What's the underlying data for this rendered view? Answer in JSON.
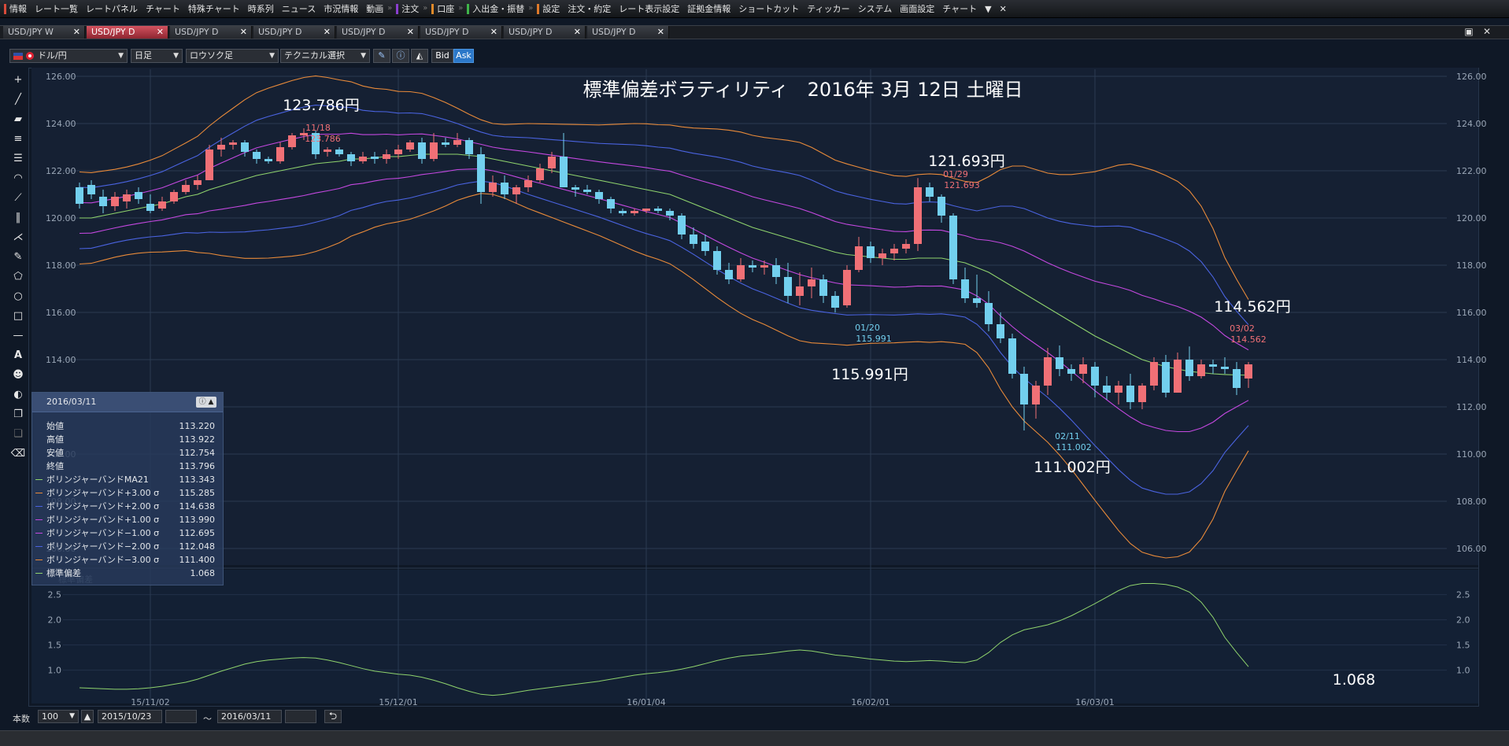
{
  "menu": [
    {
      "label": "情報",
      "mark": "#d94b3a"
    },
    {
      "label": "レート一覧"
    },
    {
      "label": "レートパネル"
    },
    {
      "label": "チャート"
    },
    {
      "label": "特殊チャート"
    },
    {
      "label": "時系列"
    },
    {
      "label": "ニュース"
    },
    {
      "label": "市況情報"
    },
    {
      "label": "動画"
    },
    {
      "label": "注文",
      "mark": "#8a3fd0",
      "sep": true
    },
    {
      "label": "口座",
      "mark": "#e08a2a",
      "sep": true
    },
    {
      "label": "入出金・振替",
      "mark": "#3fb54a",
      "sep": true
    },
    {
      "label": "設定",
      "mark": "#e07a2a",
      "sep": true
    },
    {
      "label": "注文・約定"
    },
    {
      "label": "レート表示設定"
    },
    {
      "label": "証拠金情報"
    },
    {
      "label": "ショートカット"
    },
    {
      "label": "ティッカー"
    },
    {
      "label": "システム"
    },
    {
      "label": "画面設定"
    },
    {
      "label": "チャート"
    },
    {
      "label": "▼"
    },
    {
      "label": "✕"
    }
  ],
  "tabs": [
    "USD/JPY W",
    "USD/JPY D",
    "USD/JPY D",
    "USD/JPY D",
    "USD/JPY D",
    "USD/JPY D",
    "USD/JPY D",
    "USD/JPY D"
  ],
  "active_tab": 1,
  "tab_close": "✕",
  "toolbar": {
    "currency": "ドル/円",
    "timeframe": "日足",
    "chart_type": "ロウソク足",
    "technical": "テクニカル選択",
    "bid": "Bid",
    "ask": "Ask"
  },
  "chart_title": "標準偏差ボラティリティ　2016年 3月 12日 土曜日",
  "annotations": {
    "high1_big": "123.786円",
    "high1_small_date": "11/18",
    "high1_small_val": "123.786",
    "high2_big": "121.693円",
    "high2_small_date": "01/29",
    "high2_small_val": "121.693",
    "low1_big": "115.991円",
    "low1_small_date": "01/20",
    "low1_small_val": "115.991",
    "low2_big": "111.002円",
    "low2_small_date": "02/11",
    "low2_small_val": "111.002",
    "high3_big": "114.562円",
    "high3_small_date": "03/02",
    "high3_small_val": "114.562",
    "sd_last": "1.068"
  },
  "data_panel": {
    "date": "2016/03/11",
    "rows": [
      {
        "label": "始値",
        "value": "113.220",
        "color": ""
      },
      {
        "label": "高値",
        "value": "113.922",
        "color": ""
      },
      {
        "label": "安値",
        "value": "112.754",
        "color": ""
      },
      {
        "label": "終値",
        "value": "113.796",
        "color": ""
      },
      {
        "label": "ボリンジャーバンドMA21",
        "value": "113.343",
        "color": "#8fd36d"
      },
      {
        "label": "ボリンジャーバンド+3.00 σ",
        "value": "115.285",
        "color": "#e88a3a"
      },
      {
        "label": "ボリンジャーバンド+2.00 σ",
        "value": "114.638",
        "color": "#4a63e0"
      },
      {
        "label": "ボリンジャーバンド+1.00 σ",
        "value": "113.990",
        "color": "#c448e0"
      },
      {
        "label": "ボリンジャーバンド−1.00 σ",
        "value": "112.695",
        "color": "#c448e0"
      },
      {
        "label": "ボリンジャーバンド−2.00 σ",
        "value": "112.048",
        "color": "#4a63e0"
      },
      {
        "label": "ボリンジャーバンド−3.00 σ",
        "value": "111.400",
        "color": "#e88a3a"
      },
      {
        "label": "標準偏差",
        "value": "1.068",
        "color": "#8fd36d"
      }
    ],
    "sub_label": "標準偏差"
  },
  "statusbar": {
    "count_label": "本数",
    "count_value": "100",
    "date_from": "2015/10/23",
    "tilde": "〜",
    "date_to": "2016/03/11"
  },
  "chart_data": {
    "type": "candlestick",
    "title": "標準偏差ボラティリティ　2016年 3月 12日 土曜日",
    "y_ticks": [
      "126.00",
      "124.00",
      "122.00",
      "120.00",
      "118.00",
      "116.00",
      "114.00",
      "112.00",
      "110.00",
      "108.00",
      "106.00"
    ],
    "ylim": [
      105.3,
      126.3
    ],
    "x_ticks": [
      "15/11/02",
      "15/12/01",
      "16/01/04",
      "16/02/01",
      "16/03/01"
    ],
    "x_tick_index": [
      6,
      27,
      48,
      67,
      86
    ],
    "colors": {
      "up": "#f07076",
      "down": "#72cfee",
      "ma": "#8fd36d",
      "s3": "#e88a3a",
      "s2": "#4a63e0",
      "s1": "#c448e0",
      "sd": "#8fd36d"
    },
    "candles_ohlc": [
      [
        121.3,
        121.5,
        120.4,
        120.6
      ],
      [
        121.4,
        121.6,
        120.8,
        121.0
      ],
      [
        120.9,
        121.2,
        120.2,
        120.5
      ],
      [
        120.5,
        121.1,
        120.3,
        120.9
      ],
      [
        120.7,
        121.2,
        120.4,
        121.0
      ],
      [
        121.1,
        121.3,
        120.6,
        120.8
      ],
      [
        120.6,
        121.0,
        120.2,
        120.3
      ],
      [
        120.4,
        120.9,
        120.3,
        120.7
      ],
      [
        120.7,
        121.2,
        120.6,
        121.1
      ],
      [
        121.1,
        121.6,
        121.0,
        121.4
      ],
      [
        121.4,
        121.8,
        121.2,
        121.6
      ],
      [
        121.6,
        123.1,
        121.6,
        122.9
      ],
      [
        122.9,
        123.4,
        122.6,
        123.1
      ],
      [
        123.1,
        123.3,
        122.9,
        123.2
      ],
      [
        123.2,
        123.3,
        122.6,
        122.8
      ],
      [
        122.8,
        122.9,
        122.3,
        122.5
      ],
      [
        122.5,
        122.6,
        122.3,
        122.4
      ],
      [
        122.4,
        123.2,
        122.3,
        123.0
      ],
      [
        123.0,
        123.6,
        122.9,
        123.5
      ],
      [
        123.5,
        123.8,
        123.3,
        123.6
      ],
      [
        123.6,
        123.7,
        122.5,
        122.7
      ],
      [
        122.8,
        123.0,
        122.6,
        122.9
      ],
      [
        122.9,
        123.0,
        122.6,
        122.7
      ],
      [
        122.7,
        122.8,
        122.2,
        122.4
      ],
      [
        122.4,
        122.8,
        122.3,
        122.6
      ],
      [
        122.6,
        122.8,
        122.3,
        122.5
      ],
      [
        122.5,
        122.9,
        122.3,
        122.7
      ],
      [
        122.7,
        123.1,
        122.5,
        122.9
      ],
      [
        122.9,
        123.3,
        122.8,
        123.2
      ],
      [
        123.2,
        123.4,
        122.3,
        122.5
      ],
      [
        122.5,
        123.6,
        122.4,
        123.2
      ],
      [
        123.2,
        123.4,
        123.0,
        123.1
      ],
      [
        123.1,
        123.6,
        123.0,
        123.3
      ],
      [
        123.3,
        123.4,
        122.5,
        122.7
      ],
      [
        122.7,
        123.0,
        120.6,
        121.1
      ],
      [
        121.1,
        121.8,
        120.9,
        121.5
      ],
      [
        121.5,
        121.8,
        120.8,
        121.0
      ],
      [
        121.0,
        121.4,
        120.6,
        121.3
      ],
      [
        121.3,
        121.8,
        121.1,
        121.6
      ],
      [
        121.6,
        122.3,
        121.5,
        122.1
      ],
      [
        122.1,
        122.8,
        121.9,
        122.6
      ],
      [
        122.6,
        123.6,
        121.8,
        121.3
      ],
      [
        121.3,
        121.4,
        120.9,
        121.2
      ],
      [
        121.2,
        121.4,
        121.0,
        121.1
      ],
      [
        121.1,
        121.2,
        120.6,
        120.8
      ],
      [
        120.8,
        120.9,
        120.2,
        120.4
      ],
      [
        120.3,
        120.4,
        120.1,
        120.2
      ],
      [
        120.2,
        120.4,
        120.1,
        120.3
      ],
      [
        120.3,
        120.4,
        120.2,
        120.4
      ],
      [
        120.4,
        120.5,
        120.2,
        120.3
      ],
      [
        120.3,
        120.4,
        119.9,
        120.1
      ],
      [
        120.1,
        120.2,
        119.1,
        119.3
      ],
      [
        119.3,
        119.6,
        118.7,
        118.9
      ],
      [
        119.0,
        119.3,
        118.4,
        118.6
      ],
      [
        118.6,
        118.8,
        117.6,
        117.8
      ],
      [
        117.8,
        118.1,
        117.2,
        117.4
      ],
      [
        117.4,
        118.3,
        117.3,
        118.0
      ],
      [
        118.0,
        118.2,
        117.7,
        117.9
      ],
      [
        117.9,
        118.2,
        117.6,
        118.0
      ],
      [
        118.0,
        118.3,
        117.2,
        117.5
      ],
      [
        117.5,
        118.1,
        116.4,
        116.7
      ],
      [
        116.7,
        117.7,
        116.3,
        117.1
      ],
      [
        117.1,
        117.9,
        116.6,
        117.4
      ],
      [
        117.4,
        117.6,
        116.4,
        116.7
      ],
      [
        116.7,
        116.9,
        115.99,
        116.2
      ],
      [
        116.3,
        118.0,
        116.2,
        117.8
      ],
      [
        117.8,
        119.2,
        117.7,
        118.8
      ],
      [
        118.8,
        119.0,
        118.1,
        118.3
      ],
      [
        118.3,
        118.7,
        118.0,
        118.5
      ],
      [
        118.5,
        118.9,
        118.2,
        118.7
      ],
      [
        118.7,
        119.1,
        118.5,
        118.9
      ],
      [
        118.9,
        121.69,
        118.6,
        121.3
      ],
      [
        121.3,
        121.5,
        120.7,
        120.9
      ],
      [
        120.9,
        121.0,
        119.8,
        120.1
      ],
      [
        120.1,
        120.2,
        117.2,
        117.4
      ],
      [
        117.4,
        117.9,
        116.4,
        116.6
      ],
      [
        116.6,
        117.6,
        116.2,
        116.4
      ],
      [
        116.4,
        116.9,
        115.2,
        115.5
      ],
      [
        115.5,
        116.0,
        114.7,
        114.9
      ],
      [
        114.9,
        115.1,
        113.2,
        113.4
      ],
      [
        113.4,
        113.7,
        111.0,
        112.1
      ],
      [
        112.1,
        113.1,
        111.5,
        112.9
      ],
      [
        112.9,
        114.5,
        112.5,
        114.1
      ],
      [
        114.1,
        114.6,
        113.3,
        113.6
      ],
      [
        113.6,
        113.8,
        113.1,
        113.4
      ],
      [
        113.4,
        114.1,
        113.0,
        113.8
      ],
      [
        113.7,
        113.9,
        112.4,
        112.9
      ],
      [
        112.9,
        113.3,
        112.3,
        112.6
      ],
      [
        112.6,
        113.1,
        112.1,
        112.9
      ],
      [
        112.9,
        113.4,
        111.9,
        112.2
      ],
      [
        112.2,
        113.0,
        111.9,
        112.9
      ],
      [
        112.9,
        114.1,
        112.7,
        113.9
      ],
      [
        113.9,
        114.2,
        112.4,
        112.6
      ],
      [
        112.6,
        114.3,
        112.6,
        114.0
      ],
      [
        114.0,
        114.56,
        113.1,
        113.3
      ],
      [
        113.3,
        114.0,
        113.2,
        113.8
      ],
      [
        113.8,
        114.0,
        113.4,
        113.7
      ],
      [
        113.7,
        114.1,
        113.4,
        113.6
      ],
      [
        113.6,
        113.9,
        112.5,
        112.8
      ],
      [
        113.2,
        113.9,
        112.8,
        113.8
      ]
    ],
    "bb_ma": [
      120.0,
      120.0,
      120.1,
      120.2,
      120.3,
      120.4,
      120.5,
      120.6,
      120.75,
      120.9,
      121.0,
      121.2,
      121.35,
      121.5,
      121.65,
      121.8,
      121.9,
      122.0,
      122.1,
      122.2,
      122.3,
      122.35,
      122.4,
      122.5,
      122.5,
      122.55,
      122.6,
      122.6,
      122.65,
      122.7,
      122.7,
      122.7,
      122.7,
      122.65,
      122.6,
      122.5,
      122.4,
      122.3,
      122.2,
      122.1,
      122.0,
      121.9,
      121.8,
      121.7,
      121.6,
      121.5,
      121.4,
      121.3,
      121.2,
      121.1,
      121.0,
      120.8,
      120.6,
      120.4,
      120.2,
      120.0,
      119.8,
      119.6,
      119.45,
      119.3,
      119.15,
      119.0,
      118.85,
      118.7,
      118.55,
      118.45,
      118.4,
      118.35,
      118.3,
      118.25,
      118.25,
      118.3,
      118.3,
      118.3,
      118.2,
      118.1,
      117.9,
      117.7,
      117.4,
      117.1,
      116.8,
      116.5,
      116.2,
      115.9,
      115.6,
      115.3,
      115.0,
      114.75,
      114.5,
      114.25,
      114.0,
      113.85,
      113.7,
      113.6,
      113.5,
      113.45,
      113.4,
      113.37,
      113.35,
      113.343
    ],
    "bb_width": [
      0.65,
      0.64,
      0.63,
      0.62,
      0.62,
      0.63,
      0.65,
      0.68,
      0.72,
      0.76,
      0.82,
      0.9,
      0.98,
      1.05,
      1.12,
      1.17,
      1.2,
      1.22,
      1.24,
      1.25,
      1.24,
      1.2,
      1.15,
      1.09,
      1.03,
      0.98,
      0.95,
      0.92,
      0.9,
      0.86,
      0.8,
      0.73,
      0.65,
      0.58,
      0.52,
      0.5,
      0.52,
      0.56,
      0.6,
      0.63,
      0.66,
      0.69,
      0.72,
      0.75,
      0.78,
      0.82,
      0.86,
      0.9,
      0.93,
      0.95,
      0.98,
      1.02,
      1.07,
      1.13,
      1.19,
      1.24,
      1.28,
      1.3,
      1.32,
      1.35,
      1.38,
      1.4,
      1.38,
      1.34,
      1.3,
      1.28,
      1.25,
      1.22,
      1.2,
      1.18,
      1.17,
      1.18,
      1.19,
      1.18,
      1.16,
      1.15,
      1.2,
      1.35,
      1.55,
      1.7,
      1.8,
      1.85,
      1.9,
      1.98,
      2.08,
      2.2,
      2.32,
      2.45,
      2.58,
      2.68,
      2.72,
      2.72,
      2.7,
      2.65,
      2.55,
      2.35,
      2.05,
      1.65,
      1.35,
      1.068
    ],
    "sd_ticks": [
      "2.5",
      "2.0",
      "1.5",
      "1.0"
    ],
    "sd_ylim": [
      0.4,
      2.9
    ]
  }
}
